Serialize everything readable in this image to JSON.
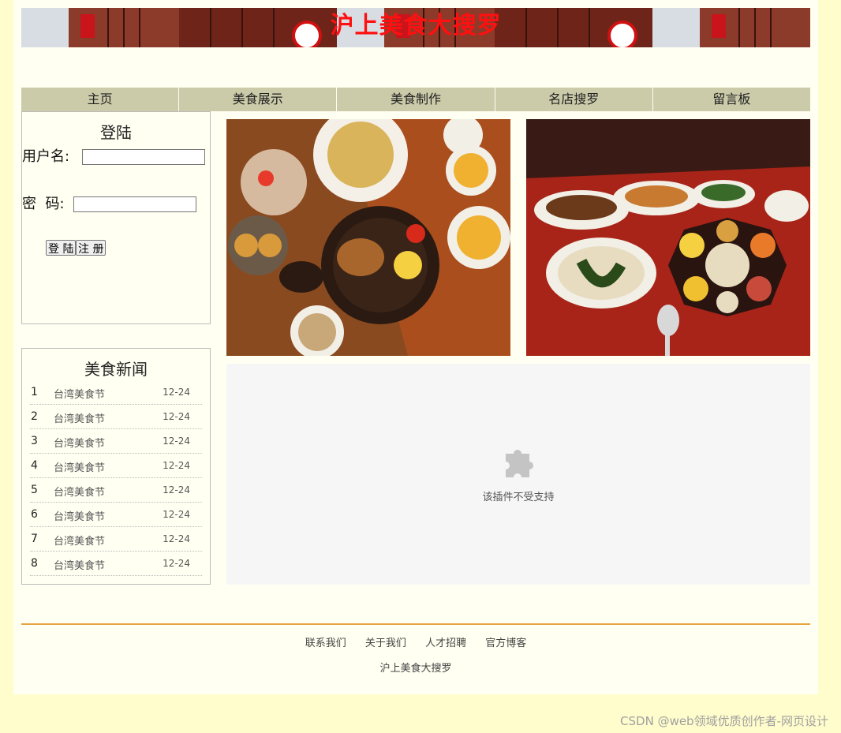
{
  "banner": {
    "title": "沪上美食大搜罗"
  },
  "nav": {
    "items": [
      "主页",
      "美食展示",
      "美食制作",
      "名店搜罗",
      "留言板"
    ]
  },
  "login": {
    "title": "登陆",
    "username_label": "用户名:",
    "password_label": "密  码:",
    "username_value": "",
    "password_value": "",
    "login_button": "登 陆",
    "register_button": "注 册"
  },
  "news": {
    "title": "美食新闻",
    "items": [
      {
        "num": "1",
        "title": "台湾美食节",
        "date": "12-24"
      },
      {
        "num": "2",
        "title": "台湾美食节",
        "date": "12-24"
      },
      {
        "num": "3",
        "title": "台湾美食节",
        "date": "12-24"
      },
      {
        "num": "4",
        "title": "台湾美食节",
        "date": "12-24"
      },
      {
        "num": "5",
        "title": "台湾美食节",
        "date": "12-24"
      },
      {
        "num": "6",
        "title": "台湾美食节",
        "date": "12-24"
      },
      {
        "num": "7",
        "title": "台湾美食节",
        "date": "12-24"
      },
      {
        "num": "8",
        "title": "台湾美食节",
        "date": "12-24"
      }
    ]
  },
  "plugin": {
    "message": "该插件不受支持"
  },
  "footer": {
    "links": [
      "联系我们",
      "关于我们",
      "人才招聘",
      "官方博客"
    ],
    "site_name": "沪上美食大搜罗"
  },
  "watermark": "CSDN @web领域优质创作者-网页设计",
  "colors": {
    "page_bg": "#fffdcc",
    "content_bg": "#fffff2",
    "nav_bg": "#cbcba9",
    "banner_title": "#ff1010",
    "footer_line": "#e8a440"
  }
}
